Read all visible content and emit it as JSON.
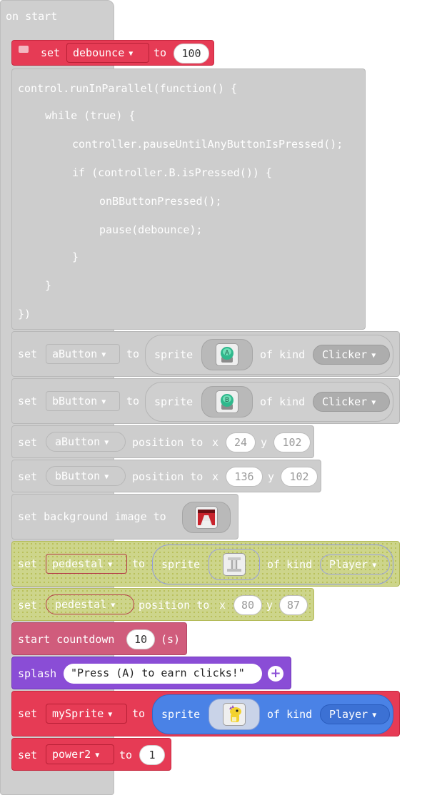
{
  "hat": {
    "label": "on start"
  },
  "debounce_block": {
    "set": "set",
    "variable": "debounce",
    "to": "to",
    "value": "100"
  },
  "js_block": {
    "lines": [
      "control.runInParallel(function() {",
      "while (true) {",
      "controller.pauseUntilAnyButtonIsPressed();",
      "if (controller.B.isPressed()) {",
      "onBButtonPressed();",
      "pause(debounce);",
      "}",
      "}",
      "})"
    ]
  },
  "abutton_block": {
    "set": "set",
    "variable": "aButton",
    "to": "to",
    "sprite": "sprite",
    "of_kind": "of kind",
    "kind": "Clicker"
  },
  "bbutton_block": {
    "set": "set",
    "variable": "bButton",
    "to": "to",
    "sprite": "sprite",
    "of_kind": "of kind",
    "kind": "Clicker"
  },
  "apos_block": {
    "set": "set",
    "variable": "aButton",
    "position_to": "position to",
    "x_label": "x",
    "x": "24",
    "y_label": "y",
    "y": "102"
  },
  "bpos_block": {
    "set": "set",
    "variable": "bButton",
    "position_to": "position to",
    "x_label": "x",
    "x": "136",
    "y_label": "y",
    "y": "102"
  },
  "bg_block": {
    "label": "set background image to"
  },
  "pedestal_block": {
    "set": "set",
    "variable": "pedestal",
    "to": "to",
    "sprite": "sprite",
    "of_kind": "of kind",
    "kind": "Player"
  },
  "pedpos_block": {
    "set": "set",
    "variable": "pedestal",
    "position_to": "position to",
    "x_label": "x",
    "x": "80",
    "y_label": "y",
    "y": "87"
  },
  "countdown_block": {
    "label": "start countdown",
    "value": "10",
    "unit": "(s)"
  },
  "splash_block": {
    "label": "splash",
    "text": "\"Press (A) to earn clicks!\""
  },
  "mysprite_block": {
    "set": "set",
    "variable": "mySprite",
    "to": "to",
    "sprite": "sprite",
    "of_kind": "of kind",
    "kind": "Player"
  },
  "power_block": {
    "set": "set",
    "variable": "power2",
    "to": "to",
    "value": "1"
  },
  "colors": {
    "red": "#e63b55",
    "gray": "#cdcdcd",
    "blue": "#4a82e6",
    "purple": "#8a4dd6",
    "pink": "#d05c7c",
    "olive": "#cdd58b"
  }
}
